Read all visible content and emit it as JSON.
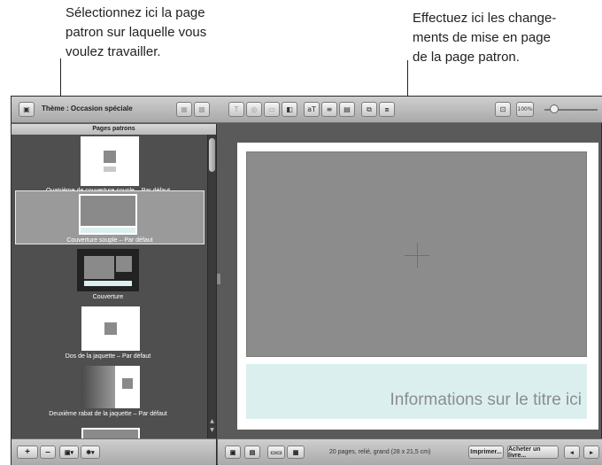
{
  "annotations": {
    "left_callout": [
      "Sélectionnez ici la page",
      "patron sur laquelle vous",
      "voulez travailler."
    ],
    "right_callout": [
      "Effectuez ici les change-",
      "ments de mise en page",
      "de la page patron."
    ]
  },
  "toolbar": {
    "theme_label": "Thème : Occasion spéciale",
    "zoom_label": "100%",
    "icons": [
      "layout-icon",
      "text-icon",
      "filter-icon",
      "photo-icon",
      "font-icon",
      "columns-icon",
      "page-icon",
      "align-icon",
      "arrange-icon"
    ]
  },
  "sidebar": {
    "header": "Pages patrons",
    "items": [
      {
        "label": "Quatrième de couverture souple – Par défaut"
      },
      {
        "label": "Couverture souple – Par défaut",
        "selected": true,
        "thumb_text": "Informations sur le titre ici"
      },
      {
        "label": "Couverture"
      },
      {
        "label": "Dos de la jaquette – Par défaut"
      },
      {
        "label": "Deuxième rabat de la jaquette – Par défaut"
      }
    ]
  },
  "canvas": {
    "title_text": "Informations sur le titre ici"
  },
  "bottom": {
    "add_label": "+",
    "remove_label": "–",
    "status": "20 pages, relié, grand (28 x 21,5 cm)",
    "print_label": "Imprimer...",
    "buy_label": "Acheter un livre...",
    "prev_label": "◂",
    "next_label": "▸"
  },
  "colors": {
    "app_bg": "#5a5a5a",
    "panel_bg": "#4f4f4f",
    "title_box": "#dcefef",
    "selected_item": "#9a9a9a"
  }
}
